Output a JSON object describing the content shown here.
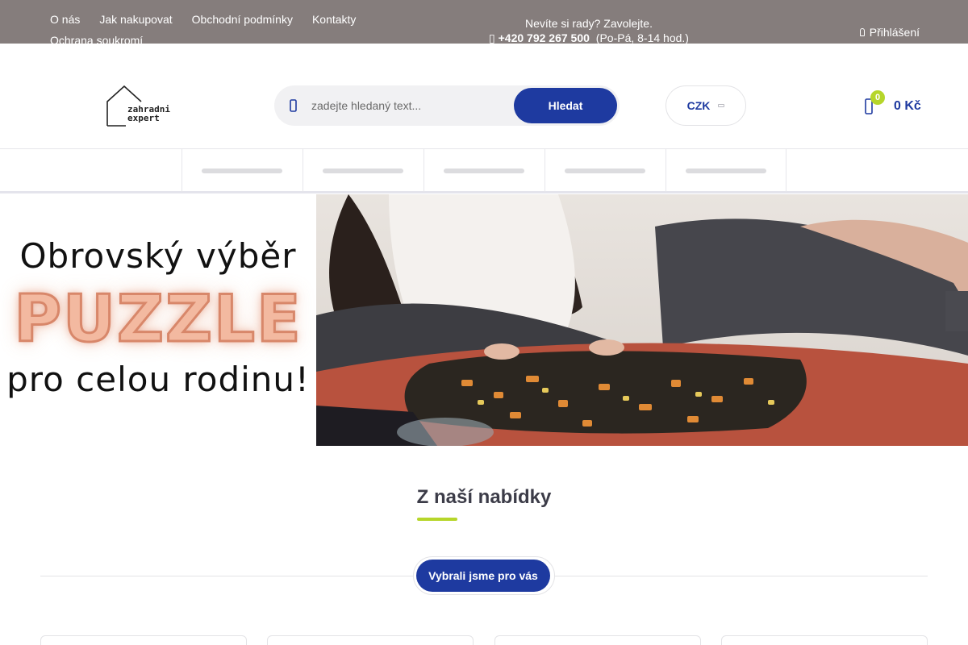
{
  "topbar": {
    "links": [
      "O nás",
      "Jak nakupovat",
      "Obchodní podmínky",
      "Kontakty",
      "Ochrana soukromí"
    ],
    "help_text": "Nevíte si rady? Zavolejte.",
    "phone": "+420 792 267 500",
    "hours": "(Po-Pá, 8-14 hod.)",
    "login_label": "Přihlášení"
  },
  "header": {
    "logo_line1": "zahradni",
    "logo_line2": "expert",
    "search": {
      "placeholder": "zadejte hledaný text...",
      "button_label": "Hledat"
    },
    "currency": "CZK",
    "cart": {
      "count": "0",
      "total": "0 Kč"
    }
  },
  "banner": {
    "line1": "Obrovský výběr",
    "line2": "PUZZLE",
    "line3": "pro celou rodinu!"
  },
  "offers": {
    "title": "Z naší nabídky",
    "tab_label": "Vybrali jsme pro vás"
  },
  "colors": {
    "topbar_bg": "#857d7c",
    "brand_blue": "#1e3aa0",
    "accent_green": "#b6d62a"
  },
  "icons": [
    "user-icon",
    "search-icon",
    "chevron-down-icon",
    "cart-icon",
    "phone-icon"
  ]
}
